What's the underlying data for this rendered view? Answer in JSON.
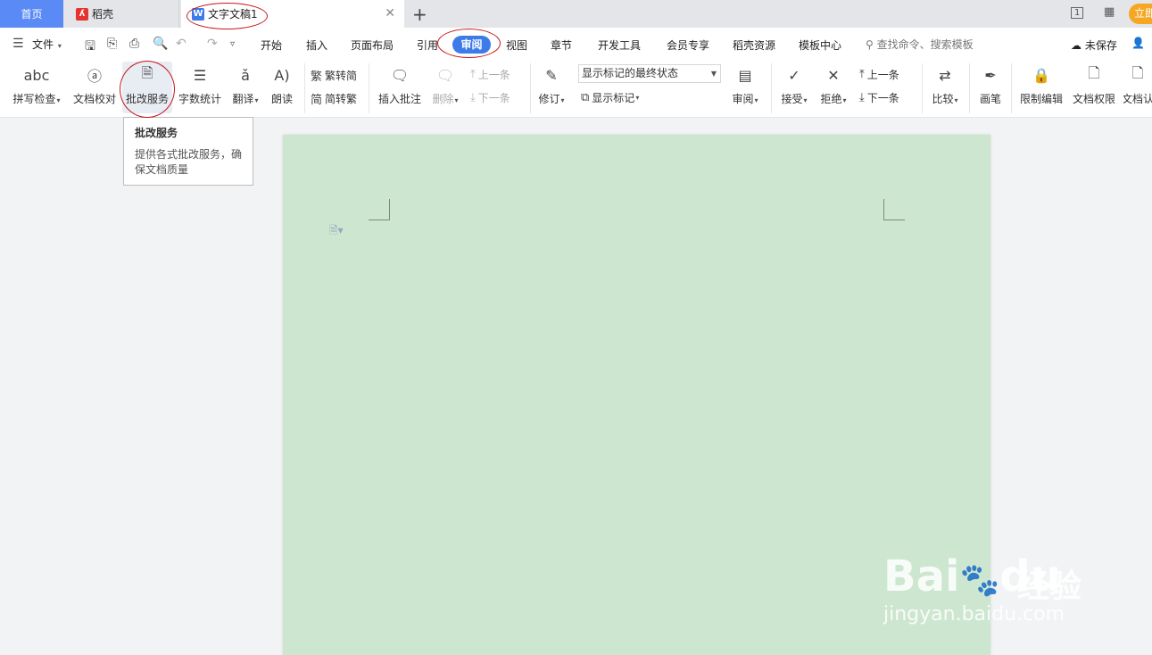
{
  "tabs": {
    "home": "首页",
    "daoke": "稻壳",
    "doc": "文字文稿1"
  },
  "titlebar_right": {
    "page_badge": "1",
    "cta": "立即"
  },
  "menu": {
    "file": "文件",
    "items": [
      "开始",
      "插入",
      "页面布局",
      "引用",
      "审阅",
      "视图",
      "章节",
      "开发工具",
      "会员专享",
      "稻壳资源",
      "模板中心"
    ],
    "active": "审阅",
    "search": "查找命令、搜索模板",
    "unsaved": "未保存"
  },
  "ribbon": {
    "spell_check": "拼写检查",
    "doc_proof": "文档校对",
    "review_service": "批改服务",
    "word_count": "字数统计",
    "translate": "翻译",
    "read_aloud": "朗读",
    "trad_to_simp": "繁转简",
    "simp_to_trad": "简转繁",
    "insert_comment": "插入批注",
    "delete": "删除",
    "prev": "上一条",
    "next": "下一条",
    "track_changes": "修订",
    "markup_state": "显示标记的最终状态",
    "show_markup": "显示标记",
    "review_pane": "审阅",
    "accept": "接受",
    "reject": "拒绝",
    "prev_change": "上一条",
    "next_change": "下一条",
    "compare": "比较",
    "pen": "画笔",
    "restrict_edit": "限制编辑",
    "doc_permission": "文档权限",
    "doc_cert": "文档认"
  },
  "tooltip": {
    "title": "批改服务",
    "desc": "提供各式批改服务，确保文档质量"
  },
  "watermark": {
    "brand": "Bai",
    "brand2": "du",
    "cn": "经验",
    "url": "jingyan.baidu.com"
  },
  "colors": {
    "accent": "#3c7be8",
    "page": "#cde6d0",
    "annotation": "#c8161e"
  }
}
